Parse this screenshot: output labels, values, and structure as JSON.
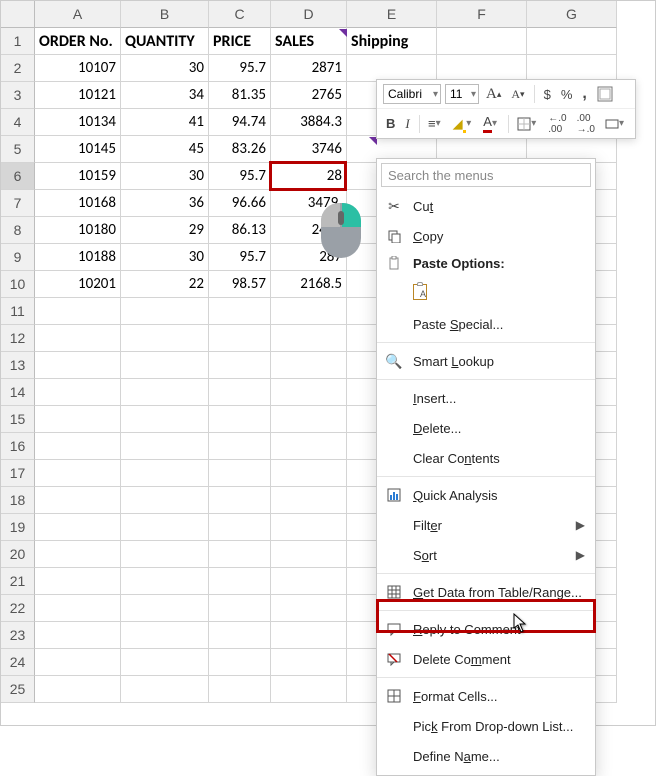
{
  "columns": [
    "A",
    "B",
    "C",
    "D",
    "E",
    "F",
    "G"
  ],
  "row_count": 25,
  "active_row": 6,
  "header_row": {
    "a": "ORDER No.",
    "b": "QUANTITY",
    "c": "PRICE",
    "d": "SALES",
    "e": "Shipping"
  },
  "data_rows": [
    {
      "a": "10107",
      "b": "30",
      "c": "95.7",
      "d": "2871"
    },
    {
      "a": "10121",
      "b": "34",
      "c": "81.35",
      "d": "2765"
    },
    {
      "a": "10134",
      "b": "41",
      "c": "94.74",
      "d": "3884.3"
    },
    {
      "a": "10145",
      "b": "45",
      "c": "83.26",
      "d": "3746"
    },
    {
      "a": "10159",
      "b": "30",
      "c": "95.7",
      "d": "28"
    },
    {
      "a": "10168",
      "b": "36",
      "c": "96.66",
      "d": "3479."
    },
    {
      "a": "10180",
      "b": "29",
      "c": "86.13",
      "d": "2497"
    },
    {
      "a": "10188",
      "b": "30",
      "c": "95.7",
      "d": "287"
    },
    {
      "a": "10201",
      "b": "22",
      "c": "98.57",
      "d": "2168.5"
    }
  ],
  "selection_highlight": {
    "row": 6,
    "col": "D"
  },
  "toolbar": {
    "font_name": "Calibri",
    "font_size": "11",
    "bold": "B",
    "italic": "I",
    "inc": "A",
    "dec": "A",
    "currency": "$",
    "percent": "%",
    "comma": ",",
    "fmt": "⊞",
    "align": "≡",
    "fill": "⬛",
    "font_color": "A",
    "border": "⊞",
    "dec_inc": ".00",
    "dec_dec": ".0"
  },
  "ctx": {
    "search_placeholder": "Search the menus",
    "cut": "Cut",
    "copy": "Copy",
    "paste_options": "Paste Options:",
    "paste_special": "Paste Special...",
    "smart_lookup": "Smart Lookup",
    "insert": "Insert...",
    "delete": "Delete...",
    "clear": "Clear Contents",
    "quick": "Quick Analysis",
    "filter": "Filter",
    "sort": "Sort",
    "getdata": "Get Data from Table/Range...",
    "reply": "Reply to Comment",
    "delcomment": "Delete Comment",
    "formatcells": "Format Cells...",
    "pickfrom": "Pick From Drop-down List...",
    "definename": "Define Name..."
  }
}
